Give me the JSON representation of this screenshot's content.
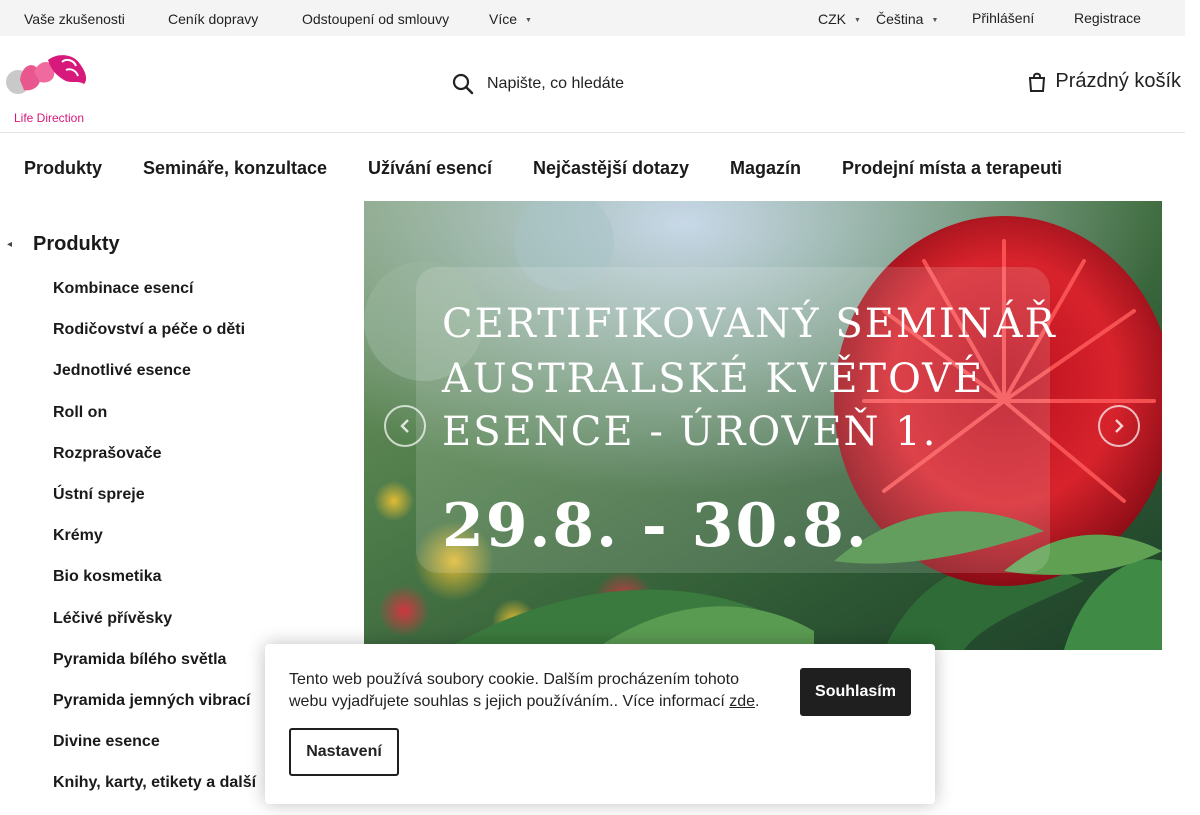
{
  "topbar": {
    "links": [
      "Vaše zkušenosti",
      "Ceník dopravy",
      "Odstoupení od smlouvy"
    ],
    "more_label": "Více",
    "currency": "CZK",
    "language": "Čeština",
    "login": "Přihlášení",
    "register": "Registrace"
  },
  "header": {
    "logo_text": "Life Direction",
    "search_placeholder": "Napište, co hledáte",
    "cart_label": "Prázdný košík",
    "brand_color": "#d6197a"
  },
  "mainnav": {
    "items": [
      "Produkty",
      "Semináře, konzultace",
      "Užívání esencí",
      "Nejčastější dotazy",
      "Magazín",
      "Prodejní místa a terapeuti"
    ]
  },
  "sidebar": {
    "title": "Produkty",
    "items": [
      "Kombinace esencí",
      "Rodičovství a péče o děti",
      "Jednotlivé esence",
      "Roll on",
      "Rozprašovače",
      "Ústní spreje",
      "Krémy",
      "Bio kosmetika",
      "Léčivé přívěsky",
      "Pyramida bílého světla",
      "Pyramida jemných vibrací",
      "Divine esence",
      "Knihy, karty, etikety a další"
    ]
  },
  "banner": {
    "line1": "CERTIFIKOVANÝ SEMINÁŘ",
    "line2": "AUSTRALSKÉ KVĚTOVÉ",
    "line3": "ESENCE - ÚROVEŇ 1.",
    "dates": "29.8. - 30.8."
  },
  "cookie": {
    "message": "Tento web používá soubory cookie. Dalším procházením tohoto webu vyjadřujete souhlas s jejich používáním.. Více informací",
    "link_text": "zde",
    "after_link": ".",
    "agree_label": "Souhlasím",
    "settings_label": "Nastavení"
  }
}
